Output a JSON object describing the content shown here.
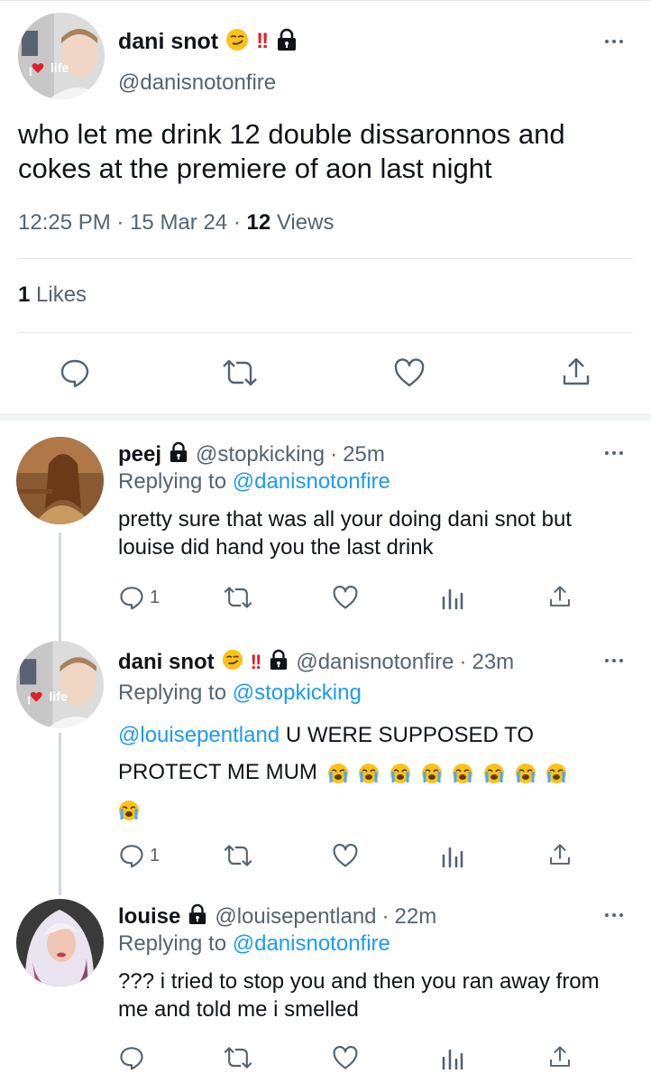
{
  "main_tweet": {
    "author_name": "dani snot",
    "author_handle": "@danisnotonfire",
    "avatar_text_i": "I",
    "avatar_text_life": "life",
    "text": "who let me drink 12 double dissaronnos and cokes at the premiere of aon last night",
    "time": "12:25 PM",
    "date": "15 Mar 24",
    "views_count": "12",
    "views_label": "Views",
    "likes_count": "1",
    "likes_label": "Likes",
    "separator": "·"
  },
  "replies": [
    {
      "author_name": "peej",
      "author_handle": "@stopkicking",
      "time_ago": "25m",
      "replying_label": "Replying to",
      "replying_to": "@danisnotonfire",
      "text": "pretty sure that was all your doing dani snot but louise did hand you the last drink",
      "reply_count": "1"
    },
    {
      "author_name": "dani snot",
      "author_handle": "@danisnotonfire",
      "time_ago": "23m",
      "replying_label": "Replying to",
      "replying_to": "@stopkicking",
      "mention": "@louisepentland",
      "text_line1": "U WERE SUPPOSED TO",
      "text_line2": "PROTECT ME MUM",
      "reply_count": "1"
    },
    {
      "author_name": "louise",
      "author_handle": "@louisepentland",
      "time_ago": "22m",
      "replying_label": "Replying to",
      "replying_to": "@danisnotonfire",
      "text": "??? i tried to stop you and then you ran away from me and told me i smelled",
      "reply_count": ""
    }
  ],
  "colors": {
    "link": "#1d9bf0",
    "muted": "#536471",
    "text": "#0f1419",
    "alert": "#e0202a"
  },
  "icons": [
    "reply-icon",
    "retweet-icon",
    "like-icon",
    "views-icon",
    "share-icon",
    "lock-icon",
    "more-icon",
    "smirk-emoji",
    "crying-emoji",
    "heart-icon"
  ]
}
